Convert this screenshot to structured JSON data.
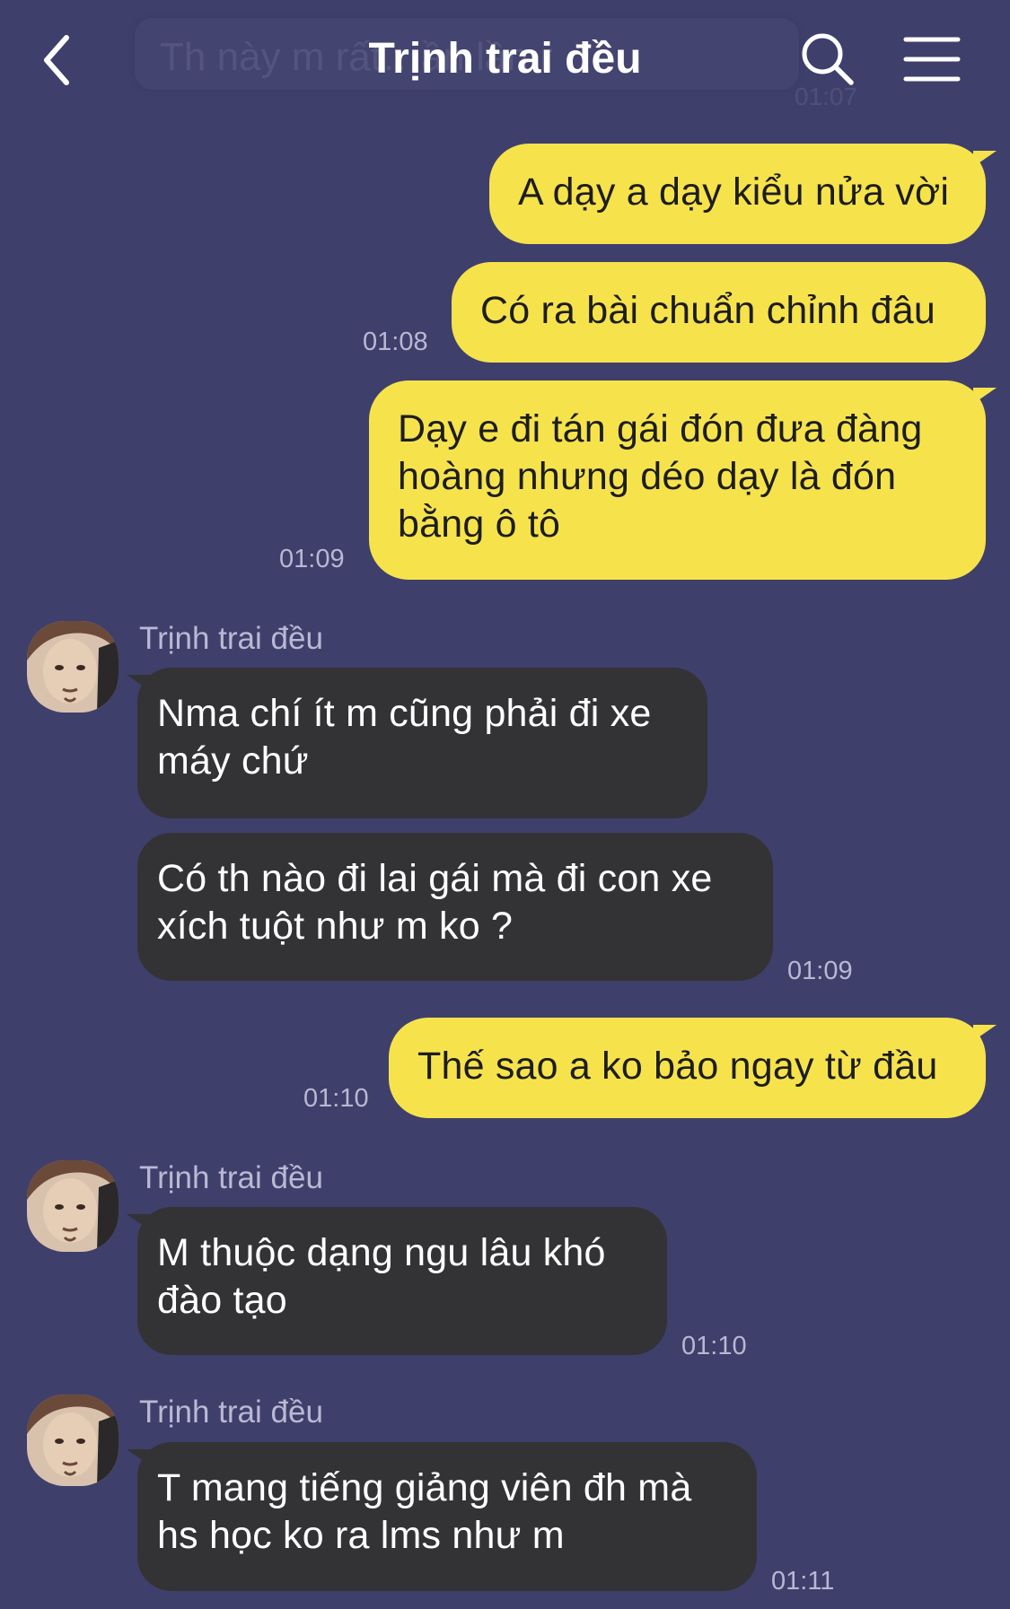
{
  "header": {
    "title": "Trịnh trai đều",
    "pinned_preview_text": "Th này m rất…ần lần r",
    "pinned_preview_time": "01:07"
  },
  "messages": [
    {
      "id": "m1",
      "from": "me",
      "text": "A dạy a dạy kiểu nửa vời",
      "time": ""
    },
    {
      "id": "m2",
      "from": "me",
      "text": "Có ra bài chuẩn chỉnh đâu",
      "time": "01:08"
    },
    {
      "id": "m3",
      "from": "me",
      "lines": [
        "Dạy e đi tán gái đón đưa đàng",
        "hoàng nhưng déo dạy là đón",
        "bằng ô tô"
      ],
      "time": "01:09"
    },
    {
      "id": "m4",
      "from": "them",
      "sender": "Trịnh trai đều",
      "lines": [
        "Nma chí ít m cũng phải đi xe",
        "máy chứ"
      ],
      "time": ""
    },
    {
      "id": "m5",
      "from": "them",
      "lines": [
        "Có th nào đi lai gái mà đi con xe",
        "xích tuột như m ko ?"
      ],
      "time": "01:09"
    },
    {
      "id": "m6",
      "from": "me",
      "text": "Thế sao a ko bảo ngay từ đầu",
      "time": "01:10"
    },
    {
      "id": "m7",
      "from": "them",
      "sender": "Trịnh trai đều",
      "lines": [
        "M thuộc dạng ngu lâu khó",
        "đào tạo"
      ],
      "time": "01:10"
    },
    {
      "id": "m8",
      "from": "them",
      "sender": "Trịnh trai đều",
      "lines": [
        "T mang tiếng giảng viên đh mà",
        "hs học ko ra lms như m"
      ],
      "time": "01:11"
    }
  ],
  "icons": {
    "back": "chevron-left-icon",
    "search": "search-icon",
    "menu": "hamburger-menu-icon"
  },
  "colors": {
    "background": "#3f3f6c",
    "my_bubble": "#f6e34c",
    "their_bubble": "#333336"
  }
}
